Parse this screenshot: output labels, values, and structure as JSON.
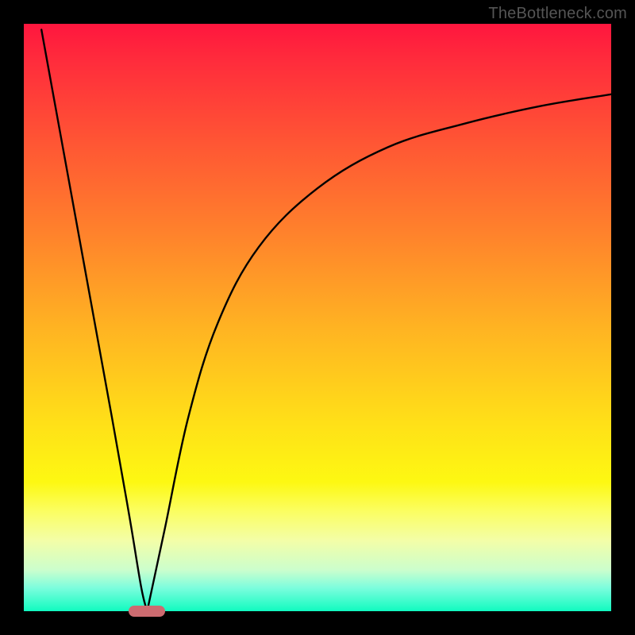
{
  "watermark": "TheBottleneck.com",
  "colors": {
    "frame": "#000000",
    "gradient_top": "#ff163e",
    "gradient_bottom": "#10fbc0",
    "curve": "#000000",
    "marker": "#cc6b70"
  },
  "chart_data": {
    "type": "line",
    "title": "",
    "xlabel": "",
    "ylabel": "",
    "xlim": [
      0,
      100
    ],
    "ylim": [
      0,
      100
    ],
    "minimum_x": 21,
    "minimum_y": 0,
    "series": [
      {
        "name": "left-branch",
        "x": [
          3,
          7,
          11,
          15,
          18,
          20,
          21
        ],
        "y": [
          99,
          77,
          55,
          33,
          16,
          4,
          0
        ]
      },
      {
        "name": "right-branch",
        "x": [
          21,
          24,
          28,
          33,
          40,
          50,
          62,
          75,
          88,
          100
        ],
        "y": [
          0,
          14,
          33,
          49,
          62,
          72,
          79,
          83,
          86,
          88
        ]
      }
    ],
    "marker": {
      "x": 21,
      "y": 0,
      "width_pct": 6.2
    },
    "annotations": []
  }
}
